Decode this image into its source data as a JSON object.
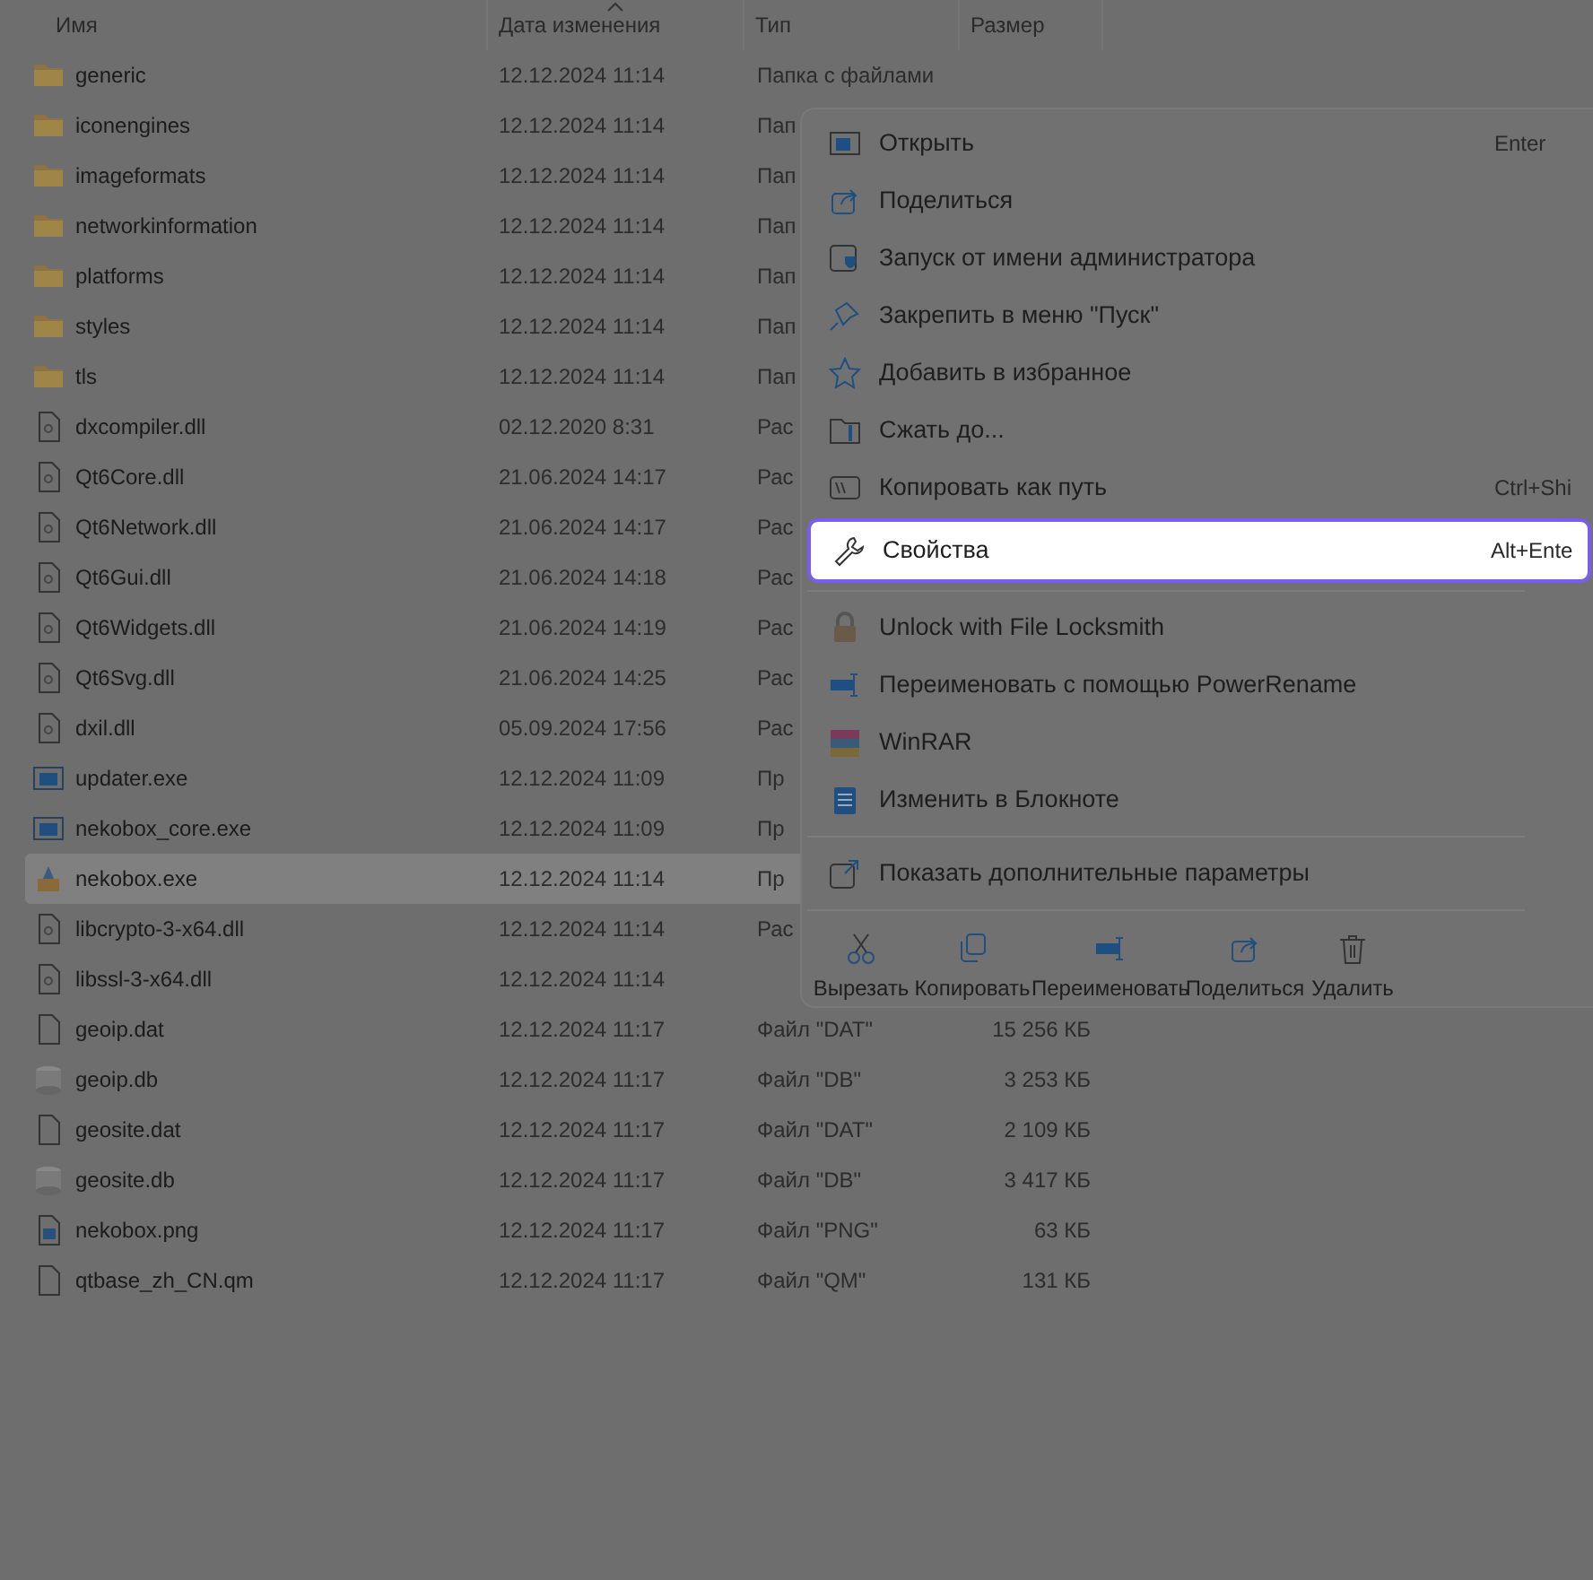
{
  "columns": [
    {
      "label": "Имя"
    },
    {
      "label": "Дата изменения",
      "sorted": true
    },
    {
      "label": "Тип"
    },
    {
      "label": "Размер"
    }
  ],
  "files": [
    {
      "kind": "folder",
      "name": "generic",
      "date": "12.12.2024 11:14",
      "type": "Папка с файлами",
      "selected": false
    },
    {
      "kind": "folder",
      "name": "iconengines",
      "date": "12.12.2024 11:14",
      "type": "Пап",
      "selected": false
    },
    {
      "kind": "folder",
      "name": "imageformats",
      "date": "12.12.2024 11:14",
      "type": "Пап",
      "selected": false
    },
    {
      "kind": "folder",
      "name": "networkinformation",
      "date": "12.12.2024 11:14",
      "type": "Пап",
      "selected": false
    },
    {
      "kind": "folder",
      "name": "platforms",
      "date": "12.12.2024 11:14",
      "type": "Пап",
      "selected": false
    },
    {
      "kind": "folder",
      "name": "styles",
      "date": "12.12.2024 11:14",
      "type": "Пап",
      "selected": false
    },
    {
      "kind": "folder",
      "name": "tls",
      "date": "12.12.2024 11:14",
      "type": "Пап",
      "selected": false
    },
    {
      "kind": "dll",
      "name": "dxcompiler.dll",
      "date": "02.12.2020 8:31",
      "type": "Рас",
      "selected": false
    },
    {
      "kind": "dll",
      "name": "Qt6Core.dll",
      "date": "21.06.2024 14:17",
      "type": "Рас",
      "selected": false
    },
    {
      "kind": "dll",
      "name": "Qt6Network.dll",
      "date": "21.06.2024 14:17",
      "type": "Рас",
      "selected": false
    },
    {
      "kind": "dll",
      "name": "Qt6Gui.dll",
      "date": "21.06.2024 14:18",
      "type": "Рас",
      "selected": false
    },
    {
      "kind": "dll",
      "name": "Qt6Widgets.dll",
      "date": "21.06.2024 14:19",
      "type": "Рас",
      "selected": false
    },
    {
      "kind": "dll",
      "name": "Qt6Svg.dll",
      "date": "21.06.2024 14:25",
      "type": "Рас",
      "selected": false
    },
    {
      "kind": "dll",
      "name": "dxil.dll",
      "date": "05.09.2024 17:56",
      "type": "Рас",
      "selected": false
    },
    {
      "kind": "exe",
      "name": "updater.exe",
      "date": "12.12.2024 11:09",
      "type": "Пр",
      "selected": false
    },
    {
      "kind": "exe",
      "name": "nekobox_core.exe",
      "date": "12.12.2024 11:09",
      "type": "Пр",
      "selected": false
    },
    {
      "kind": "app",
      "name": "nekobox.exe",
      "date": "12.12.2024 11:14",
      "type": "Пр",
      "selected": true
    },
    {
      "kind": "dll",
      "name": "libcrypto-3-x64.dll",
      "date": "12.12.2024 11:14",
      "type": "Рас",
      "selected": false
    },
    {
      "kind": "dll",
      "name": "libssl-3-x64.dll",
      "date": "12.12.2024 11:14",
      "selected": false
    },
    {
      "kind": "file",
      "name": "geoip.dat",
      "date": "12.12.2024 11:17",
      "type": "Файл \"DAT\"",
      "size": "15 256 КБ",
      "selected": false
    },
    {
      "kind": "db",
      "name": "geoip.db",
      "date": "12.12.2024 11:17",
      "type": "Файл \"DB\"",
      "size": "3 253 КБ",
      "selected": false
    },
    {
      "kind": "file",
      "name": "geosite.dat",
      "date": "12.12.2024 11:17",
      "type": "Файл \"DAT\"",
      "size": "2 109 КБ",
      "selected": false
    },
    {
      "kind": "db",
      "name": "geosite.db",
      "date": "12.12.2024 11:17",
      "type": "Файл \"DB\"",
      "size": "3 417 КБ",
      "selected": false
    },
    {
      "kind": "image",
      "name": "nekobox.png",
      "date": "12.12.2024 11:17",
      "type": "Файл \"PNG\"",
      "size": "63 КБ",
      "selected": false
    },
    {
      "kind": "file",
      "name": "qtbase_zh_CN.qm",
      "date": "12.12.2024 11:17",
      "type": "Файл \"QM\"",
      "size": "131 КБ",
      "selected": false
    }
  ],
  "context_menu": {
    "sections": [
      [
        {
          "label": "Открыть",
          "shortcut": "Enter",
          "selected": false
        },
        {
          "label": "Поделиться",
          "selected": false
        },
        {
          "label": "Запуск от имени администратора",
          "selected": false
        },
        {
          "label": "Закрепить в меню \"Пуск\"",
          "selected": false
        },
        {
          "label": "Добавить в избранное",
          "selected": false
        },
        {
          "label": "Сжать до...",
          "selected": false
        },
        {
          "label": "Копировать как путь",
          "shortcut": "Ctrl+Shi",
          "selected": false
        },
        {
          "label": "Свойства",
          "shortcut": "Alt+Ente",
          "selected": true
        }
      ],
      [
        {
          "label": "Unlock with File Locksmith",
          "selected": false
        },
        {
          "label": "Переименовать с помощью PowerRename",
          "selected": false
        },
        {
          "label": "WinRAR",
          "selected": false
        },
        {
          "label": "Изменить в Блокноте",
          "selected": false
        }
      ],
      [
        {
          "label": "Показать дополнительные параметры",
          "selected": false
        }
      ]
    ],
    "actions": [
      {
        "label": "Вырезать"
      },
      {
        "label": "Копировать"
      },
      {
        "label": "Переименовать"
      },
      {
        "label": "Поделиться"
      },
      {
        "label": "Удалить"
      }
    ]
  }
}
